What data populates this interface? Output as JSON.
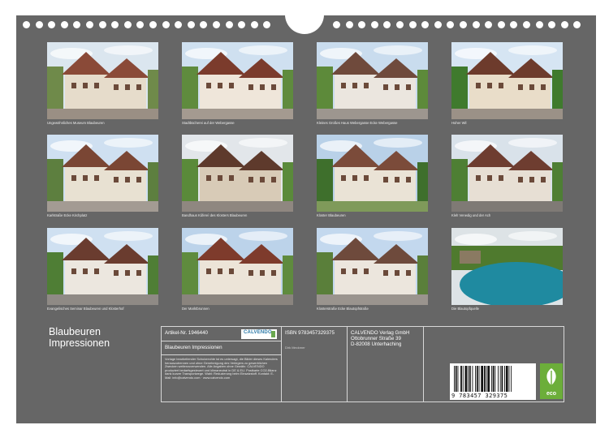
{
  "calendar": {
    "title_line1": "Blaubeuren",
    "title_line2": "Impressionen"
  },
  "photos": [
    {
      "caption": "Ungewöhnliches Museum Blaubeuren",
      "palette": {
        "sky": "#dbe6ef",
        "wall": "#e6dccb",
        "roof": "#8a4a38",
        "ground": "#9a8f84",
        "green": "#6f8a4a"
      }
    },
    {
      "caption": "Stadtbücherei auf der Webergasse",
      "palette": {
        "sky": "#cfe0f0",
        "wall": "#efe6da",
        "roof": "#7b3b2c",
        "ground": "#a49a90",
        "green": "#5f8b3e"
      }
    },
    {
      "caption": "Kleines Großes Haus Webergasse Ecke Webergasse",
      "palette": {
        "sky": "#c9dcee",
        "wall": "#ebe6df",
        "roof": "#6f4a3c",
        "ground": "#9d968f",
        "green": "#5d8a3a"
      }
    },
    {
      "caption": "Hoher Wil",
      "palette": {
        "sky": "#d6e5f3",
        "wall": "#e9ddc9",
        "roof": "#6d3b2c",
        "ground": "#9b9187",
        "green": "#3f7a2d"
      }
    },
    {
      "caption": "Karlstraße Ecke Kirchplatz",
      "palette": {
        "sky": "#cfe0f1",
        "wall": "#e8e1d2",
        "roof": "#7a4634",
        "ground": "#a39b93",
        "green": "#5d7f3f"
      }
    },
    {
      "caption": "Bandhaus Kûfereì des Klosters Blaubeuren",
      "palette": {
        "sky": "#e2e6ea",
        "wall": "#d8cbb7",
        "roof": "#5e3a2c",
        "ground": "#8f8780",
        "green": "#5a8a3a"
      }
    },
    {
      "caption": "Kloster Blaubeuren",
      "palette": {
        "sky": "#b9d1e8",
        "wall": "#eae3d6",
        "roof": "#7b4b3a",
        "ground": "#7f9a5a",
        "green": "#3e6f2c"
      }
    },
    {
      "caption": "Kleh Venedig und der Ach",
      "palette": {
        "sky": "#d9e2ea",
        "wall": "#e7dfd4",
        "roof": "#6e3d30",
        "ground": "#7f7a75",
        "green": "#4e7f34"
      }
    },
    {
      "caption": "Evangelisches Seminar Blaubeuren und Klosterhof",
      "palette": {
        "sky": "#cfe0f1",
        "wall": "#ece7df",
        "roof": "#6a3c2f",
        "ground": "#8f8a85",
        "green": "#4f7e35"
      }
    },
    {
      "caption": "Der Marktbrunnen",
      "palette": {
        "sky": "#bcd3ea",
        "wall": "#ece4d8",
        "roof": "#7e3b2c",
        "ground": "#8a847e",
        "green": "#5f8b3e"
      }
    },
    {
      "caption": "Klosterstraße Ecke Blautopfstraße",
      "palette": {
        "sky": "#c3d8ee",
        "wall": "#ece6dd",
        "roof": "#6e4a3c",
        "ground": "#9a948e",
        "green": "#5a7f3a"
      }
    },
    {
      "caption": "Die Blautopfquelle",
      "palette": {
        "sky": "#dde3e6",
        "wall": "#8a7a62",
        "roof": "#5e4b3a",
        "ground": "#1f8aa0",
        "green": "#4f7a2e"
      }
    }
  ],
  "info": {
    "article_no": "Artikel-Nr. 1946440",
    "product_title": "Blaubeuren Impressionen",
    "publisher_logo": "CALVENDO",
    "legal_text": "Vorlage bearbeitender Schutzrechte ist es untersagt, die Bilder dieses Kalenders herauszutrennen und ohne Genehmigung des Verlegers zu gewerblichen Zwecken weiterzuverwenden. Alle Angaben ohne Gewähr. CALVENDO produziert bedarfsgesteuert und klimaneutral in DE & EU. Postkarte CO2-Bilanz dank kurzer Transportwege. Wahl: Reduzierung beim Einsatzstoff. Kontakt: E-Mail: info@calvendo.com · www.calvendo.com",
    "isbn": "ISBN 9783457329375",
    "author": "Dirk Meckmer",
    "publisher_name": "CALVENDO Verlag GmbH",
    "publisher_street": "Ottobrunner Straße 39",
    "publisher_city": "D-82008 Unterhaching",
    "barcode_number": "9 783457 329375",
    "eco_label": "eco"
  },
  "colors": {
    "sheet": "#666666",
    "eco_green": "#6cae3a",
    "calvendo_blue": "#2d7aa8"
  }
}
